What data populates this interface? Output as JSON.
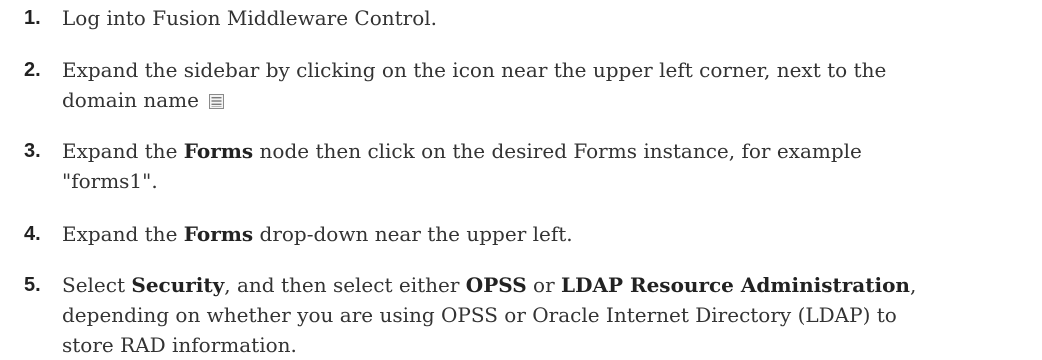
{
  "steps": [
    {
      "number": "1.",
      "parts": [
        "Log into Fusion Middleware Control."
      ]
    },
    {
      "number": "2.",
      "line1": "Expand the sidebar by clicking on the icon near the upper left corner, next to the",
      "line2": "domain name",
      "icon": "sidebar-toggle-icon"
    },
    {
      "number": "3.",
      "p1": "Expand the ",
      "b1": "Forms",
      "p2": " node then click on the desired Forms instance, for example",
      "line2": "\"forms1\"."
    },
    {
      "number": "4.",
      "p1": "Expand the ",
      "b1": "Forms",
      "p2": " drop-down near the upper left."
    },
    {
      "number": "5.",
      "p1": "Select ",
      "b1": "Security",
      "p2": ", and then select either ",
      "b2": "OPSS",
      "p3": " or ",
      "b3": "LDAP Resource Administration",
      "p4": ",",
      "line2": "depending on whether you are using OPSS or Oracle Internet Directory (LDAP) to",
      "line3": "store RAD information."
    }
  ]
}
